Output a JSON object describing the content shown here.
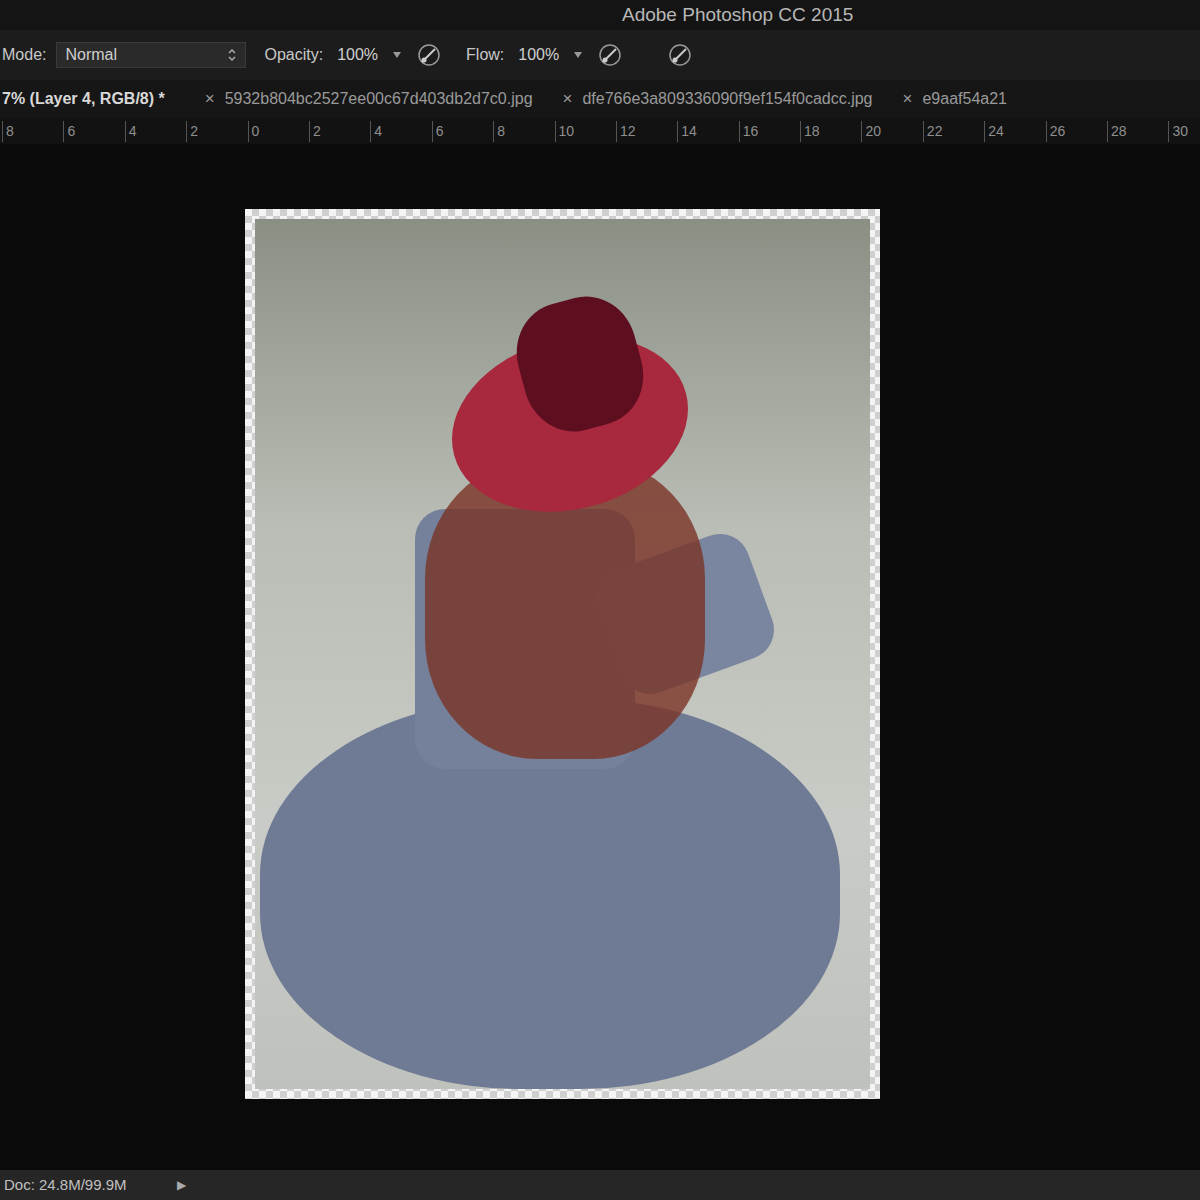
{
  "window": {
    "title": "Adobe Photoshop CC 2015"
  },
  "options_bar": {
    "mode": {
      "label": "Mode:",
      "value": "Normal"
    },
    "opacity": {
      "label": "Opacity:",
      "value": "100%"
    },
    "flow": {
      "label": "Flow:",
      "value": "100%"
    }
  },
  "tabs": [
    {
      "label": "7% (Layer 4, RGB/8) *",
      "selected": true,
      "close": ""
    },
    {
      "label": "5932b804bc2527ee00c67d403db2d7c0.jpg",
      "selected": false,
      "close": "×"
    },
    {
      "label": "dfe766e3a809336090f9ef154f0cadcc.jpg",
      "selected": false,
      "close": "×"
    },
    {
      "label": "e9aaf54a21",
      "selected": false,
      "close": "×"
    }
  ],
  "ruler": {
    "ticks": [
      "8",
      "6",
      "4",
      "2",
      "0",
      "2",
      "4",
      "6",
      "8",
      "10",
      "12",
      "14",
      "16",
      "18",
      "20",
      "22",
      "24",
      "26",
      "28",
      "30"
    ]
  },
  "status_bar": {
    "doc": "Doc: 24.8M/99.9M",
    "arrow": "▶"
  }
}
